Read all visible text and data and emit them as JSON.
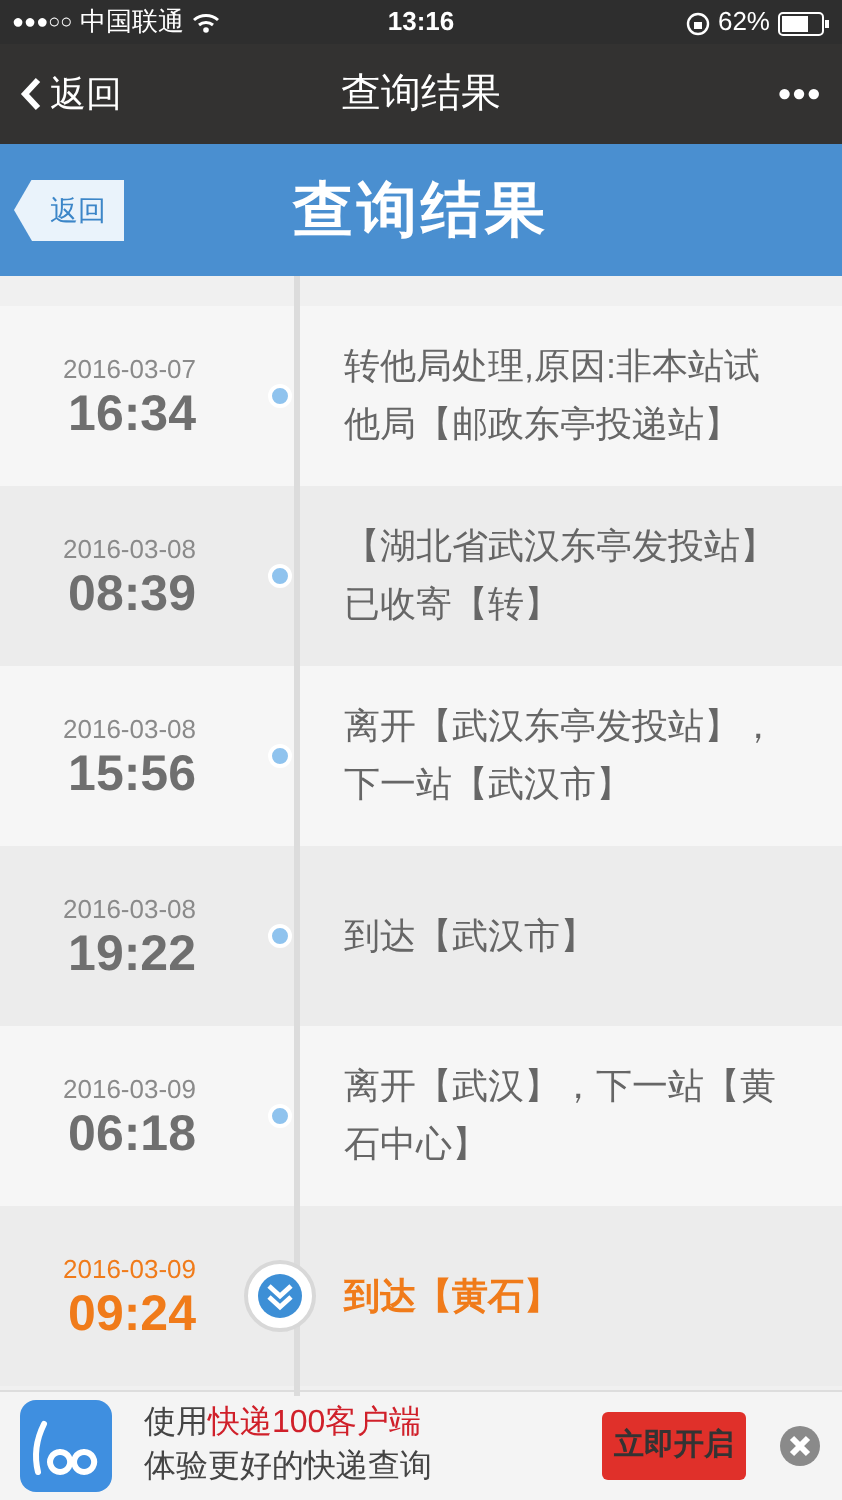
{
  "status_bar": {
    "signal": "●●●○○",
    "carrier": "中国联通",
    "time": "13:16",
    "battery": "62%"
  },
  "nav_bar": {
    "back": "返回",
    "title": "查询结果",
    "more": "•••"
  },
  "header": {
    "back": "返回",
    "title": "查询结果"
  },
  "events": [
    {
      "date": "2016-03-07",
      "time": "16:34",
      "text": "转他局处理,原因:非本站试他局【邮政东亭投递站】",
      "current": false
    },
    {
      "date": "2016-03-08",
      "time": "08:39",
      "text": "【湖北省武汉东亭发投站】已收寄【转】",
      "current": false
    },
    {
      "date": "2016-03-08",
      "time": "15:56",
      "text": "离开【武汉东亭发投站】，下一站【武汉市】",
      "current": false
    },
    {
      "date": "2016-03-08",
      "time": "19:22",
      "text": "到达【武汉市】",
      "current": false
    },
    {
      "date": "2016-03-09",
      "time": "06:18",
      "text": "离开【武汉】，下一站【黄石中心】",
      "current": false
    },
    {
      "date": "2016-03-09",
      "time": "09:24",
      "text": "到达【黄石】",
      "current": true
    }
  ],
  "banner": {
    "prefix": "使用",
    "highlight": "快递100客户端",
    "subtitle": "体验更好的快递查询",
    "button": "立即开启"
  }
}
